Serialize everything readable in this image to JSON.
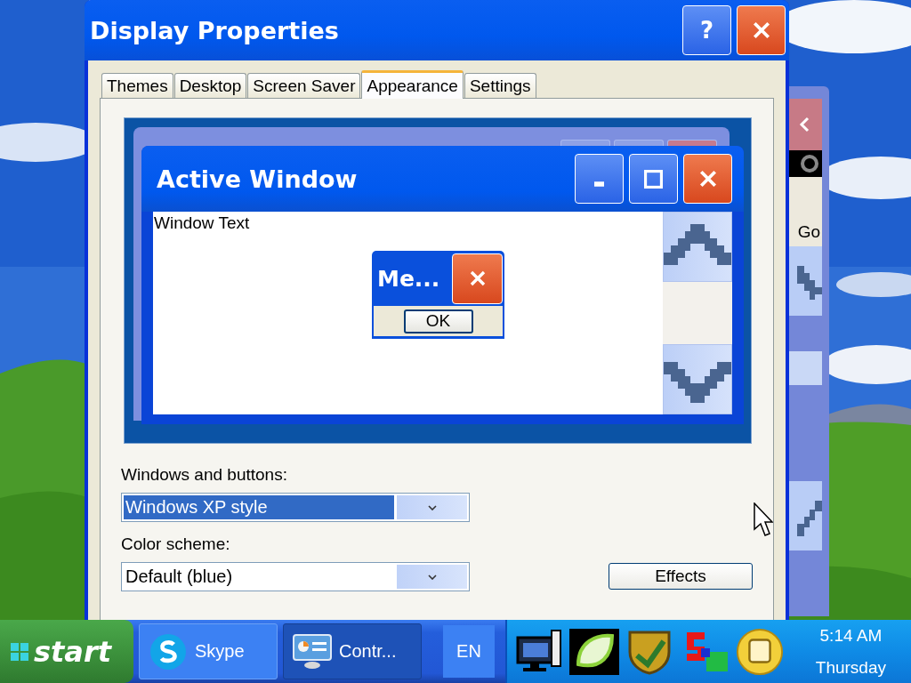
{
  "dialog": {
    "title": "Display Properties",
    "help_button": "?",
    "tabs": [
      {
        "label": "Themes",
        "selected": false
      },
      {
        "label": "Desktop",
        "selected": false
      },
      {
        "label": "Screen Saver",
        "selected": false
      },
      {
        "label": "Appearance",
        "selected": true
      },
      {
        "label": "Settings",
        "selected": false
      }
    ],
    "preview": {
      "active_window": {
        "title": "Active Window",
        "body_text": "Window Text"
      },
      "message_box": {
        "title": "Me...",
        "button": "OK"
      }
    },
    "fields": [
      {
        "label": "Windows and buttons:",
        "value": "Windows XP style",
        "focused": true
      },
      {
        "label": "Color scheme:",
        "value": "Default (blue)",
        "focused": false
      }
    ],
    "effects_button": "Effects"
  },
  "background_window": {
    "go_button": "Go"
  },
  "taskbar": {
    "start": "start",
    "tasks": [
      {
        "label": "Skype",
        "kind": "skype",
        "selected": false
      },
      {
        "label": "Contr...",
        "kind": "control-panel",
        "selected": true
      }
    ],
    "language": "EN",
    "time": "5:14 AM",
    "day": "Thursday"
  }
}
